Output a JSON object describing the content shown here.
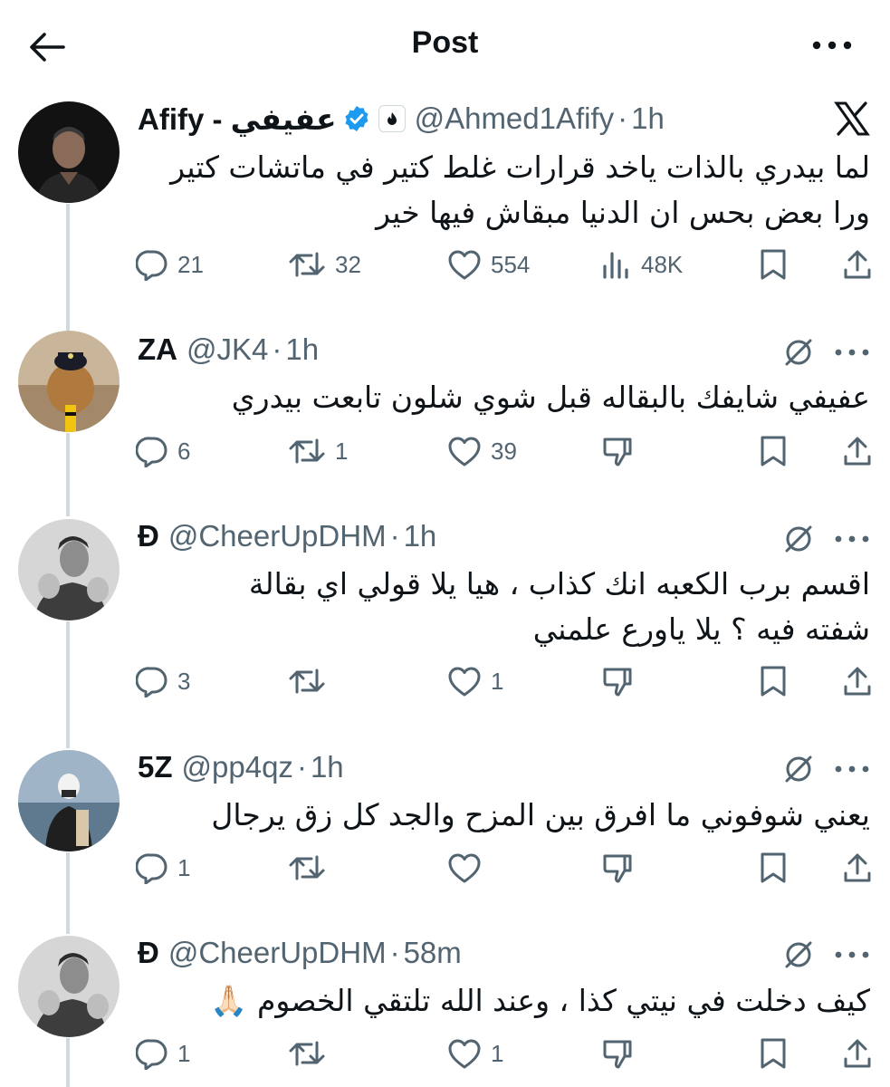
{
  "header": {
    "title": "Post"
  },
  "tweets": [
    {
      "name": "Afify - عفيفي",
      "handle": "@Ahmed1Afify",
      "time": "1h",
      "text": [
        "لما بيدري بالذات ياخد قرارات غلط كتير في ماتشات كتير",
        "ورا بعض بحس ان الدنيا مبقاش فيها خير"
      ],
      "replies": "21",
      "reposts": "32",
      "likes": "554",
      "views": "48K"
    },
    {
      "name": "ZA",
      "handle": "@JK4",
      "time": "1h",
      "text": [
        "عفيفي شايفك بالبقاله قبل شوي شلون تابعت بيدري"
      ],
      "replies": "6",
      "reposts": "1",
      "likes": "39"
    },
    {
      "name": "Đ",
      "handle": "@CheerUpDHM",
      "time": "1h",
      "text": [
        "اقسم برب الكعبه انك كذاب ، هيا يلا قولي اي بقالة",
        "شفته فيه ؟ يلا ياورع علمني"
      ],
      "replies": "3",
      "reposts": "",
      "likes": "1"
    },
    {
      "name": "5Z",
      "handle": "@pp4qz",
      "time": "1h",
      "text": [
        "يعني شوفوني ما افرق بين المزح والجد كل زق يرجال"
      ],
      "replies": "1",
      "reposts": "",
      "likes": ""
    },
    {
      "name": "Đ",
      "handle": "@CheerUpDHM",
      "time": "58m",
      "text": [
        "كيف دخلت في نيتي كذا ، وعند الله تلتقي الخصوم 🙏🏻"
      ],
      "replies": "1",
      "reposts": "",
      "likes": "1"
    }
  ],
  "colors": {
    "text": "#0f1419",
    "secondary": "#536471",
    "verified": "#1d9bf0",
    "line": "#cfd9de"
  },
  "icons": [
    "back-arrow-icon",
    "more-icon",
    "x-logo-icon",
    "verified-icon",
    "grok-icon",
    "reply-icon",
    "repost-icon",
    "like-icon",
    "views-icon",
    "bookmark-icon",
    "share-icon",
    "dislike-icon"
  ]
}
